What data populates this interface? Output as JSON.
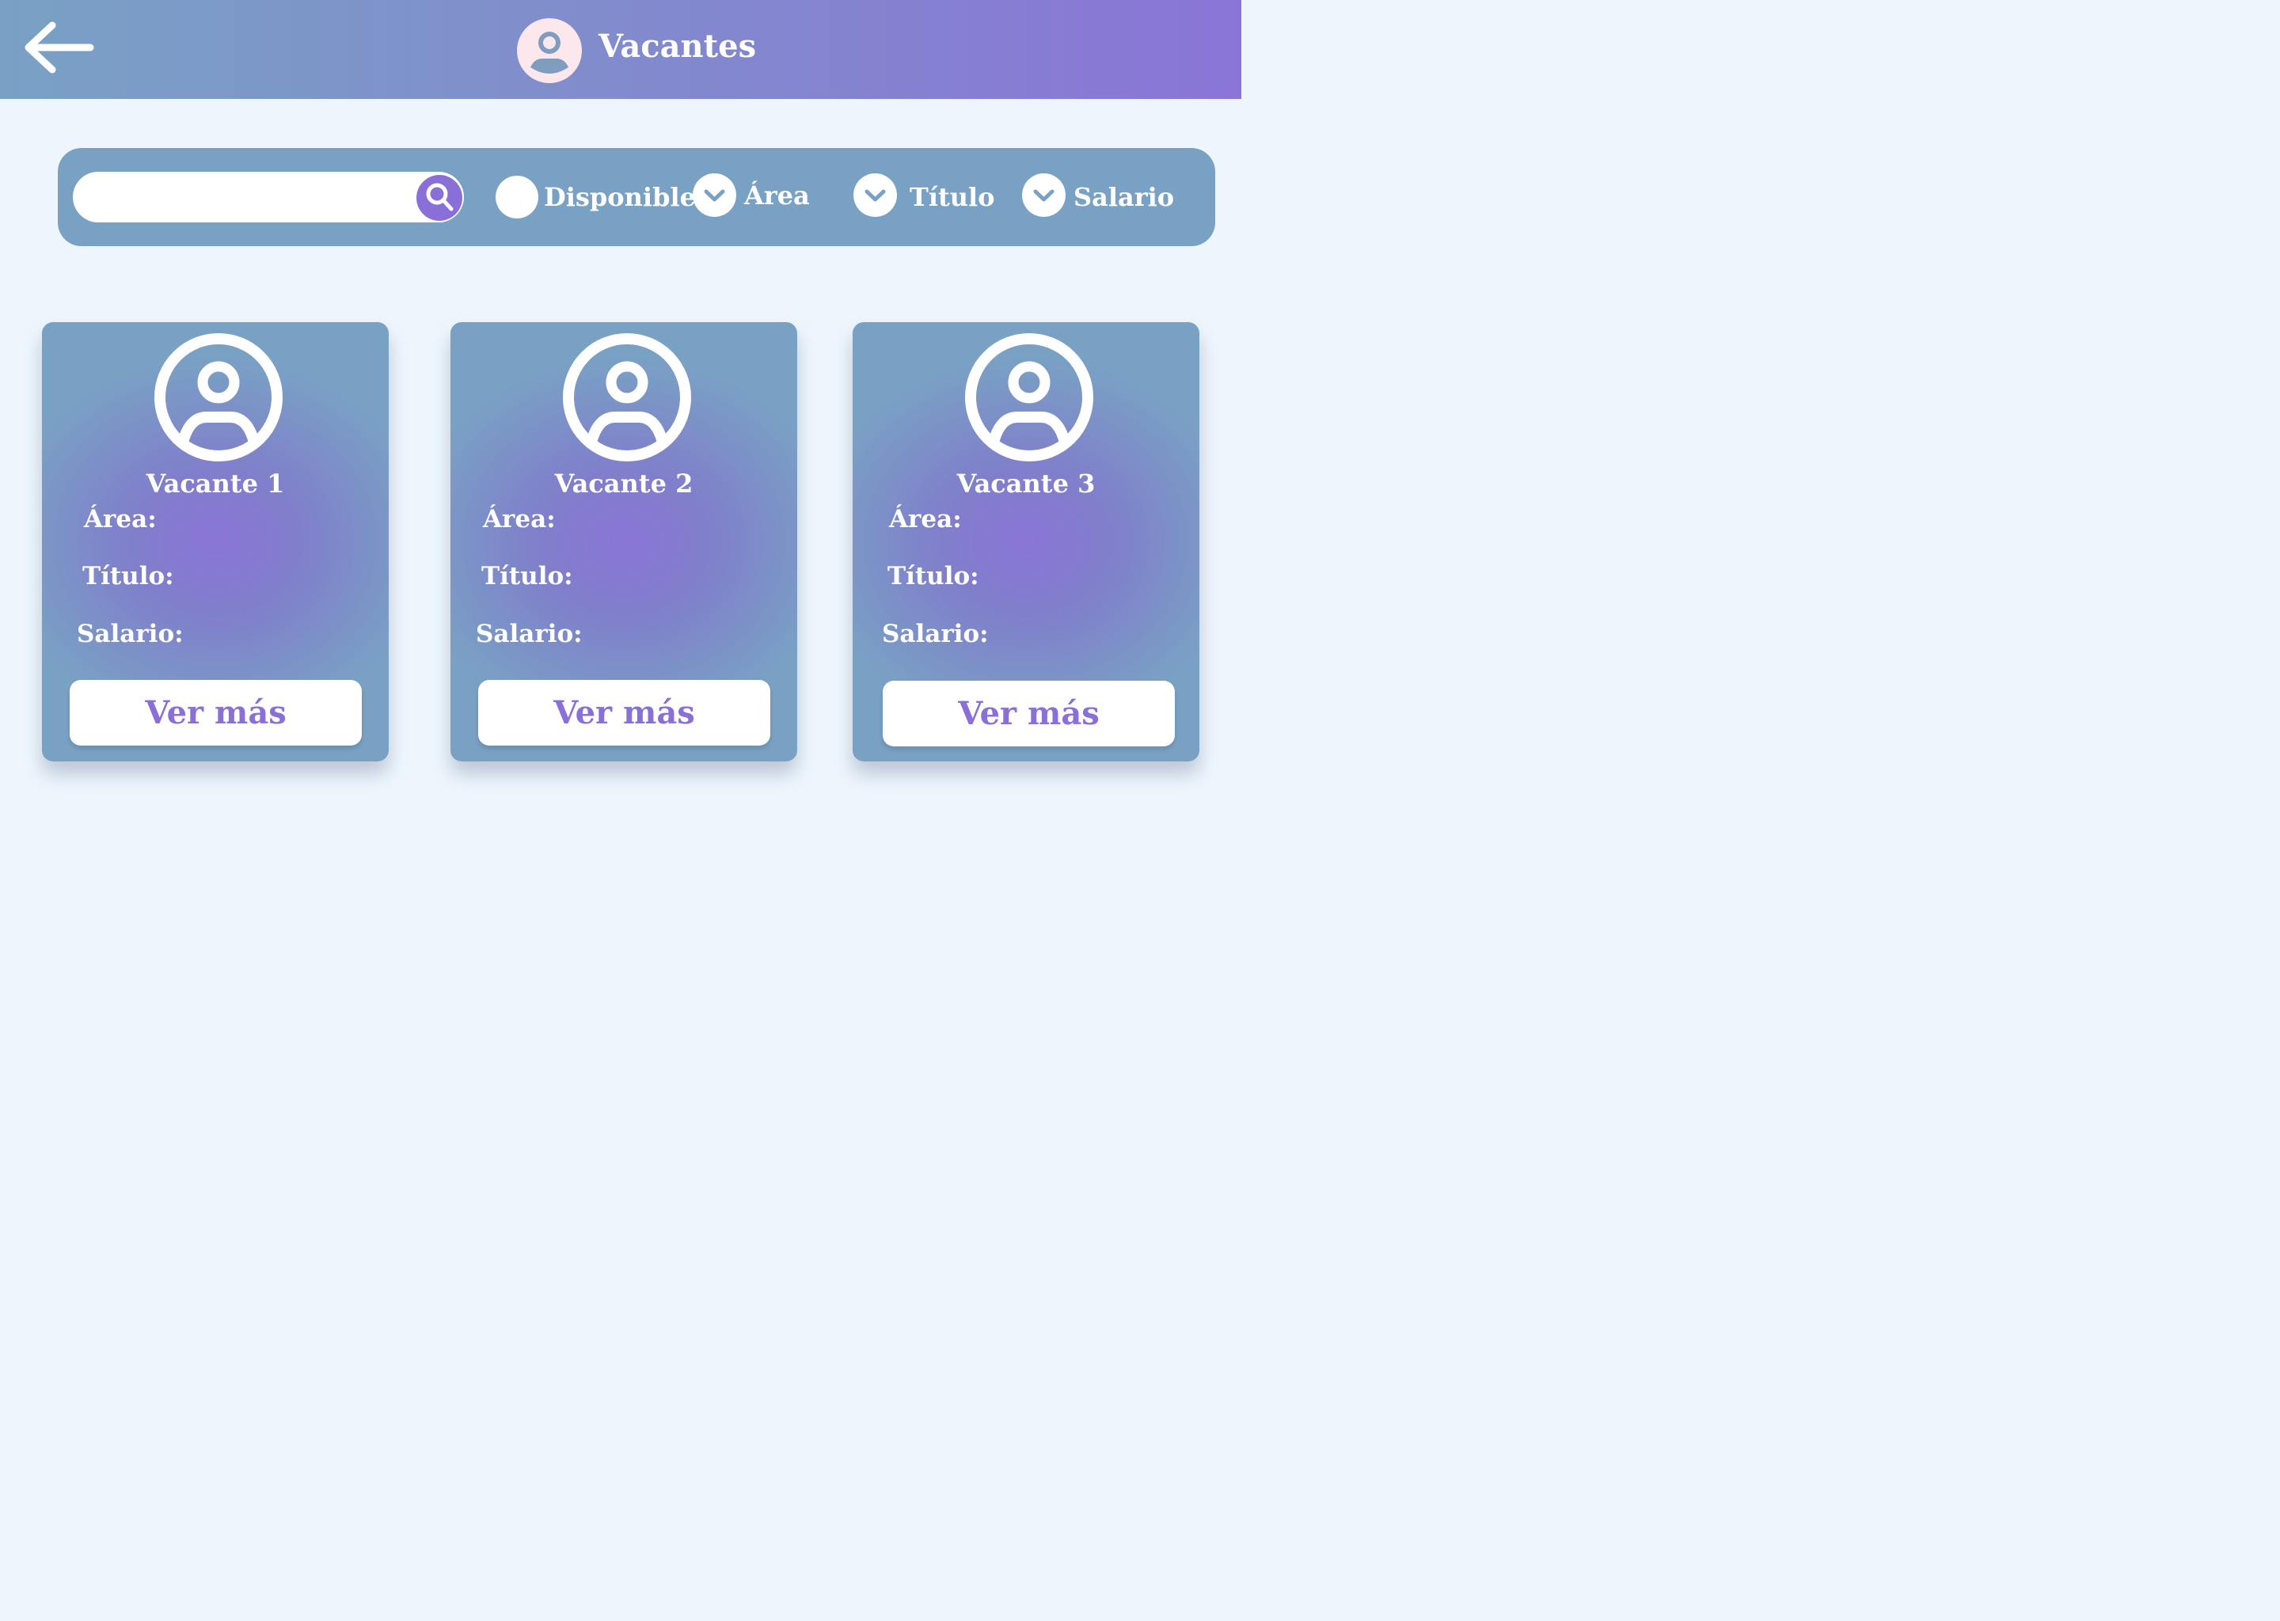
{
  "header": {
    "title": "Vacantes",
    "back_icon": "arrow-left-icon",
    "avatar_icon": "user-avatar-icon"
  },
  "filters": {
    "search_placeholder": "",
    "search_icon": "search-icon",
    "available_label": "Disponible",
    "area_label": "Área",
    "title_label": "Título",
    "salary_label": "Salario",
    "dropdown_icon": "chevron-down-icon"
  },
  "vacancies": [
    {
      "title": "Vacante 1",
      "area_label": "Área:",
      "title_label": "Título:",
      "salary_label": "Salario:",
      "button_label": "Ver más"
    },
    {
      "title": "Vacante 2",
      "area_label": "Área:",
      "title_label": "Título:",
      "salary_label": "Salario:",
      "button_label": "Ver más"
    },
    {
      "title": "Vacante 3",
      "area_label": "Área:",
      "title_label": "Título:",
      "salary_label": "Salario:",
      "button_label": "Ver más"
    }
  ],
  "colors": {
    "header_start": "#79a1c4",
    "header_end": "#8a75d6",
    "panel": "#79a1c4",
    "accent": "#8b6fd8",
    "background": "#eef6fd",
    "avatar_header_bg": "#fce8ec"
  }
}
